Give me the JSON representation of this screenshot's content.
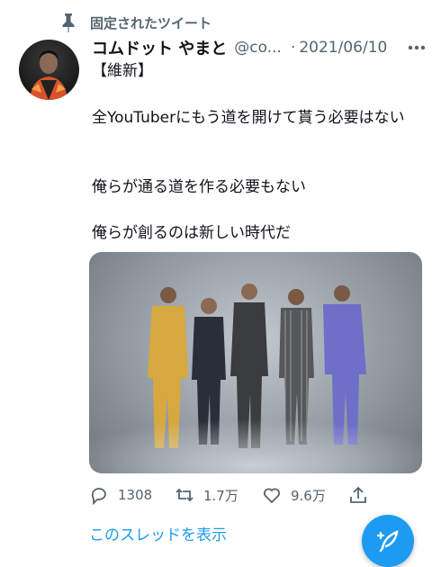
{
  "pinned_label": "固定されたツイート",
  "author": {
    "display_name": "コムドット やまと",
    "handle": "@co...",
    "separator": "·",
    "date": "2021/06/10"
  },
  "tweet": {
    "tag": "【維新】",
    "line1": "全YouTuberにもう道を開けて貰う必要はない",
    "line2": "俺らが通る道を作る必要もない",
    "line3": "俺らが創るのは新しい時代だ"
  },
  "stats": {
    "replies": "1308",
    "retweets": "1.7万",
    "likes": "9.6万"
  },
  "show_thread": "このスレッドを表示",
  "colors": {
    "accent": "#1d9bf0",
    "muted": "#536471",
    "text": "#0f1419"
  },
  "icons": {
    "pin": "pin-icon",
    "more": "more-icon",
    "reply": "reply-icon",
    "retweet": "retweet-icon",
    "like": "heart-icon",
    "share": "share-icon",
    "compose": "compose-icon"
  }
}
